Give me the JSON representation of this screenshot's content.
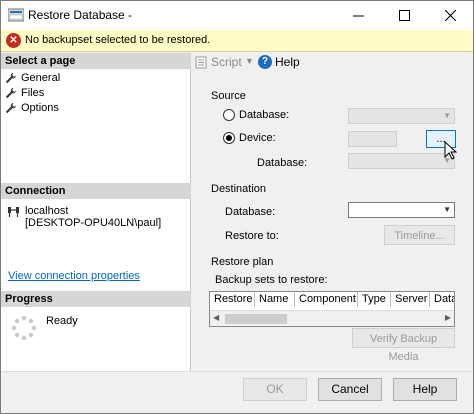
{
  "window": {
    "title": "Restore Database -"
  },
  "banner": {
    "message": "No backupset selected to be restored."
  },
  "left_pane": {
    "select_page_title": "Select a page",
    "pages": [
      {
        "label": "General"
      },
      {
        "label": "Files"
      },
      {
        "label": "Options"
      }
    ],
    "connection_title": "Connection",
    "connection_server": "localhost",
    "connection_user": "[DESKTOP-OPU40LN\\paul]",
    "view_connection_link": "View connection properties",
    "progress_title": "Progress",
    "progress_status": "Ready"
  },
  "toolbar": {
    "script_label": "Script",
    "help_label": "Help"
  },
  "source": {
    "group_label": "Source",
    "database_radio_label": "Database:",
    "device_radio_label": "Device:",
    "device_database_label": "Database:",
    "selected": "Device",
    "browse_label": "..."
  },
  "destination": {
    "group_label": "Destination",
    "database_label": "Database:",
    "restore_to_label": "Restore to:",
    "timeline_label": "Timeline..."
  },
  "restore_plan": {
    "group_label": "Restore plan",
    "backup_sets_label": "Backup sets to restore:",
    "columns": [
      "Restore",
      "Name",
      "Component",
      "Type",
      "Server",
      "Data"
    ],
    "verify_label": "Verify Backup Media"
  },
  "footer": {
    "ok_label": "OK",
    "cancel_label": "Cancel",
    "help_label": "Help"
  },
  "colors": {
    "banner_bg": "#fffbc5",
    "error_red": "#c42b1c",
    "link_blue": "#0066cc",
    "section_header": "#d6d6d6"
  }
}
